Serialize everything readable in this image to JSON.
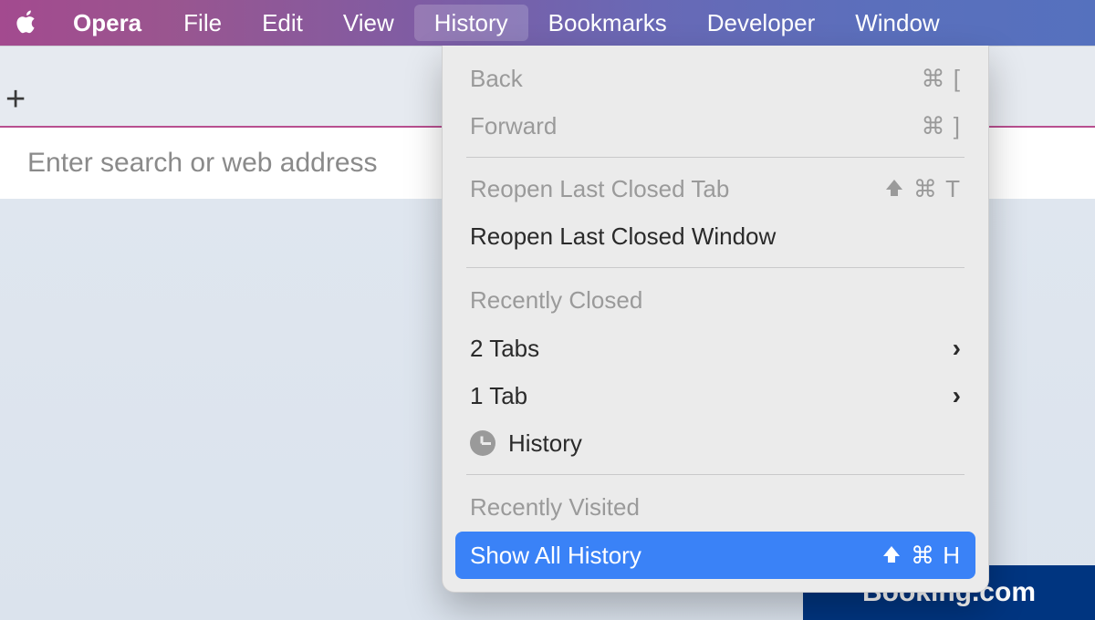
{
  "menubar": {
    "app_name": "Opera",
    "items": [
      "File",
      "Edit",
      "View",
      "History",
      "Bookmarks",
      "Developer",
      "Window"
    ],
    "active_index": 3
  },
  "addressbar": {
    "placeholder": "Enter search or web address",
    "value": ""
  },
  "dropdown": {
    "back": {
      "label": "Back",
      "shortcut": "⌘ ["
    },
    "forward": {
      "label": "Forward",
      "shortcut": "⌘ ]"
    },
    "reopen_tab": {
      "label": "Reopen Last Closed Tab",
      "shortcut": "⇧ ⌘ T"
    },
    "reopen_window": {
      "label": "Reopen Last Closed Window"
    },
    "recently_closed_header": "Recently Closed",
    "recently_closed": [
      {
        "label": "2 Tabs",
        "has_submenu": true
      },
      {
        "label": "1 Tab",
        "has_submenu": true
      },
      {
        "label": "History",
        "icon": "clock"
      }
    ],
    "recently_visited_header": "Recently Visited",
    "show_all": {
      "label": "Show All History",
      "shortcut": "⇧ ⌘ H"
    }
  },
  "page": {
    "booking_snippet": "Booking.com"
  }
}
